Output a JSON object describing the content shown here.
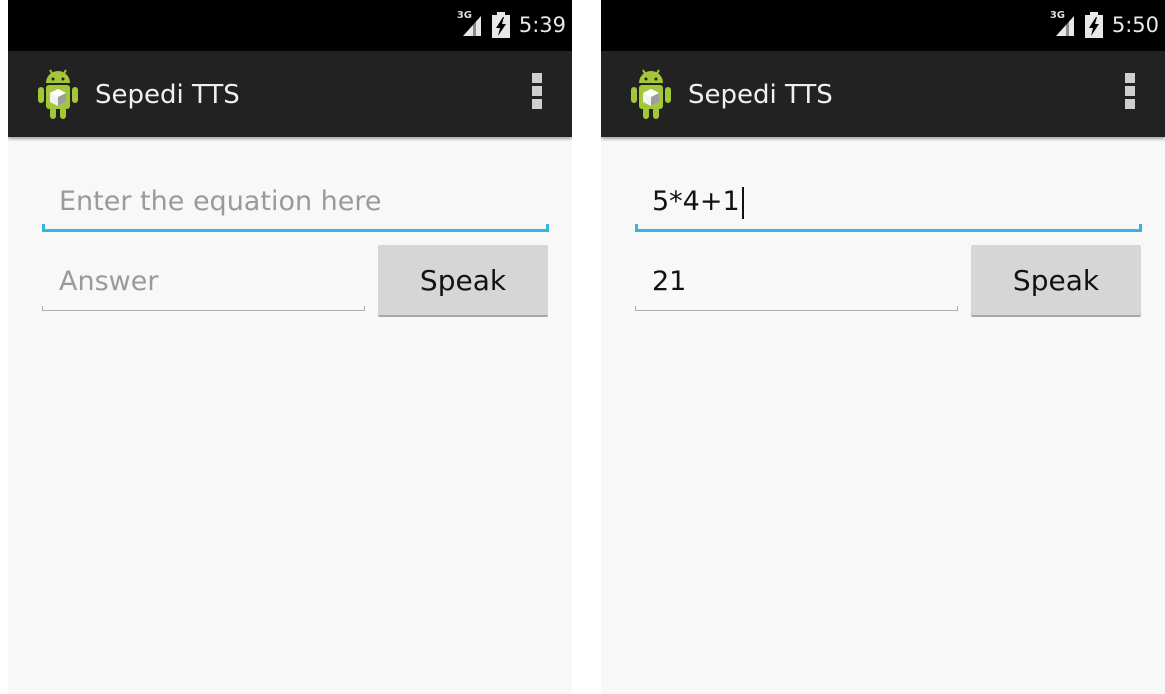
{
  "screens": [
    {
      "status": {
        "network": "3G",
        "time": "5:39"
      },
      "app": {
        "title": "Sepedi TTS",
        "logo": "android-icon",
        "menu_icon": "overflow-menu-icon"
      },
      "equation": {
        "value": "",
        "placeholder": "Enter the equation here"
      },
      "answer": {
        "value": "",
        "placeholder": "Answer"
      },
      "speak_label": "Speak"
    },
    {
      "status": {
        "network": "3G",
        "time": "5:50"
      },
      "app": {
        "title": "Sepedi TTS",
        "logo": "android-icon",
        "menu_icon": "overflow-menu-icon"
      },
      "equation": {
        "value": "5*4+1",
        "placeholder": "Enter the equation here"
      },
      "answer": {
        "value": "21",
        "placeholder": "Answer"
      },
      "speak_label": "Speak"
    }
  ],
  "colors": {
    "accent": "#33b5e5",
    "action_bar": "#222222",
    "status_bar": "#000000",
    "background": "#f8f8f8",
    "button": "#d6d6d6"
  }
}
